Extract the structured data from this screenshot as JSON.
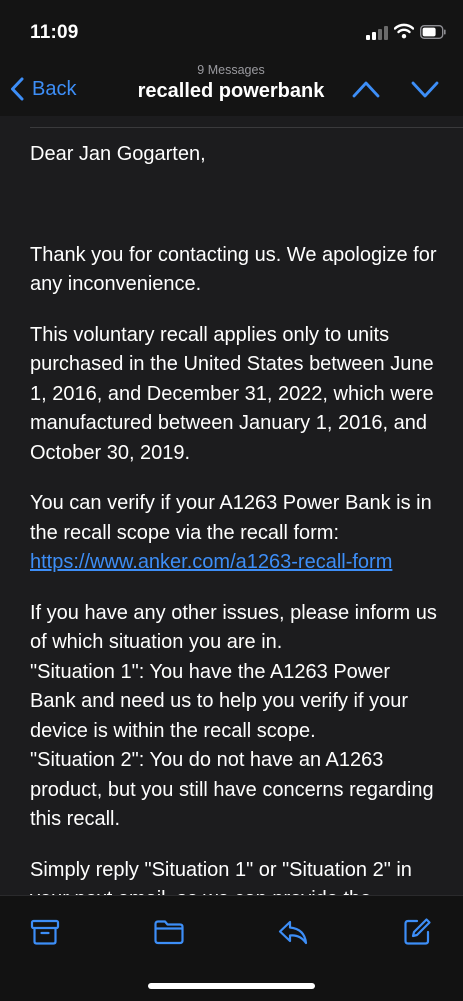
{
  "status_bar": {
    "time": "11:09",
    "icons": [
      "cellular-signal-icon",
      "wifi-icon",
      "battery-icon"
    ]
  },
  "nav": {
    "back_label": "Back",
    "message_count": "9 Messages",
    "title": "recalled powerbank",
    "icons": [
      "chevron-left-icon",
      "chevron-up-icon",
      "chevron-down-icon"
    ]
  },
  "email": {
    "greeting": "Dear Jan Gogarten,",
    "paragraphs": [
      "Thank you for contacting us. We apologize for any inconvenience.",
      "This voluntary recall applies only to units purchased in the United States between June 1, 2016, and December 31, 2022, which were manufactured between January 1, 2016, and October 30, 2019.",
      "You can verify if your A1263 Power Bank is in the recall scope via the recall form:"
    ],
    "link": "https://www.anker.com/a1263-recall-form",
    "issues_intro": "If you have any other issues, please inform us of which situation you are in.",
    "situation_1": "\"Situation 1\": You have the A1263 Power Bank and need us to help you verify if your device is within the recall scope.",
    "situation_2": "\"Situation 2\": You do not have an A1263 product, but you still have concerns regarding this recall.",
    "closing_partial": "Simply reply \"Situation 1\" or \"Situation 2\" in your next email, so we can provide the"
  },
  "toolbar": {
    "icons": [
      "archive-icon",
      "folder-icon",
      "reply-icon",
      "compose-icon"
    ]
  },
  "colors": {
    "accent": "#3d8ef7",
    "background": "#1c1c1e",
    "bar_background": "#141414",
    "text": "#ffffff",
    "secondary_text": "#9a9a9f"
  }
}
